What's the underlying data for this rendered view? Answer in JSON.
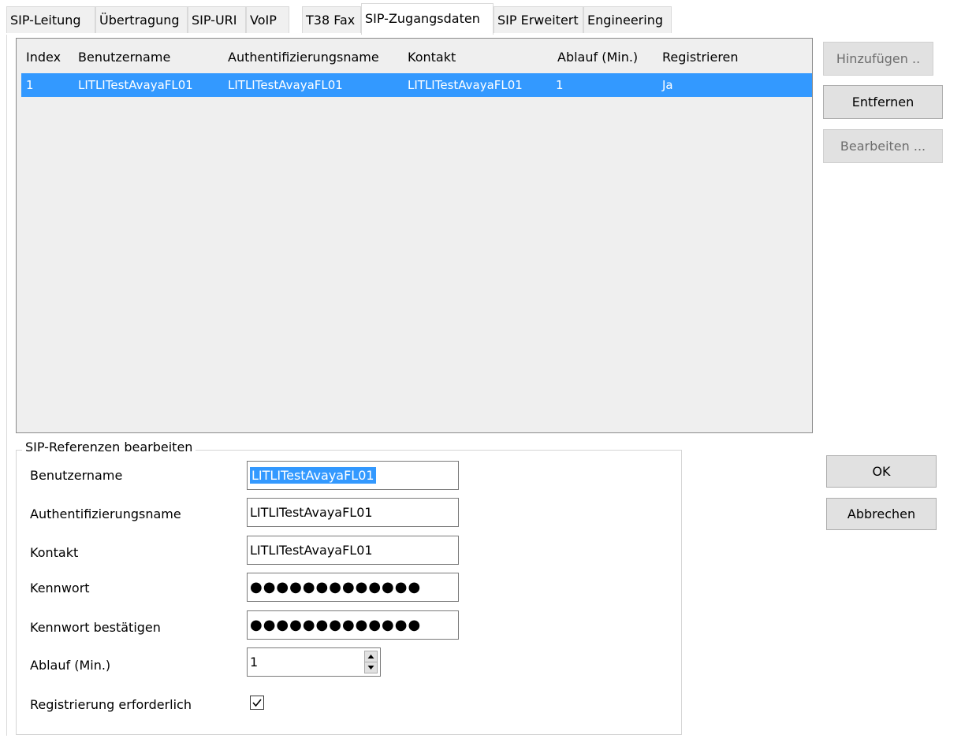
{
  "tabs": [
    {
      "label": "SIP-Leitung"
    },
    {
      "label": "Übertragung"
    },
    {
      "label": "SIP-URI"
    },
    {
      "label": "VoIP"
    },
    {
      "label": "T38 Fax"
    },
    {
      "label": "SIP-Zugangsdaten"
    },
    {
      "label": "SIP Erweitert"
    },
    {
      "label": "Engineering"
    }
  ],
  "active_tab": "SIP-Zugangsdaten",
  "table": {
    "columns": [
      "Index",
      "Benutzername",
      "Authentifizierungsname",
      "Kontakt",
      "Ablauf (Min.)",
      "Registrieren"
    ],
    "rows": [
      [
        "1",
        "LITLITestAvayaFL01",
        "LITLITestAvayaFL01",
        "LITLITestAvayaFL01",
        "1",
        "Ja"
      ]
    ],
    "selected_row": 0
  },
  "side_buttons": {
    "add": "Hinzufügen ..",
    "remove": "Entfernen",
    "edit": "Bearbeiten ..."
  },
  "form": {
    "title": "SIP-Referenzen bearbeiten",
    "username_label": "Benutzername",
    "username_value": "LITLITestAvayaFL01",
    "authname_label": "Authentifizierungsname",
    "authname_value": "LITLITestAvayaFL01",
    "contact_label": "Kontakt",
    "contact_value": "LITLITestAvayaFL01",
    "password_label": "Kennwort",
    "password_value": "●●●●●●●●●●●●●",
    "password_confirm_label": "Kennwort bestätigen",
    "password_confirm_value": "●●●●●●●●●●●●●",
    "expiry_label": "Ablauf (Min.)",
    "expiry_value": "1",
    "registration_label": "Registrierung erforderlich",
    "registration_checked": true
  },
  "dialog_buttons": {
    "ok": "OK",
    "cancel": "Abbrechen"
  },
  "colors": {
    "selection": "#3399ff",
    "button_face": "#e1e1e1",
    "list_background": "#efefef"
  }
}
